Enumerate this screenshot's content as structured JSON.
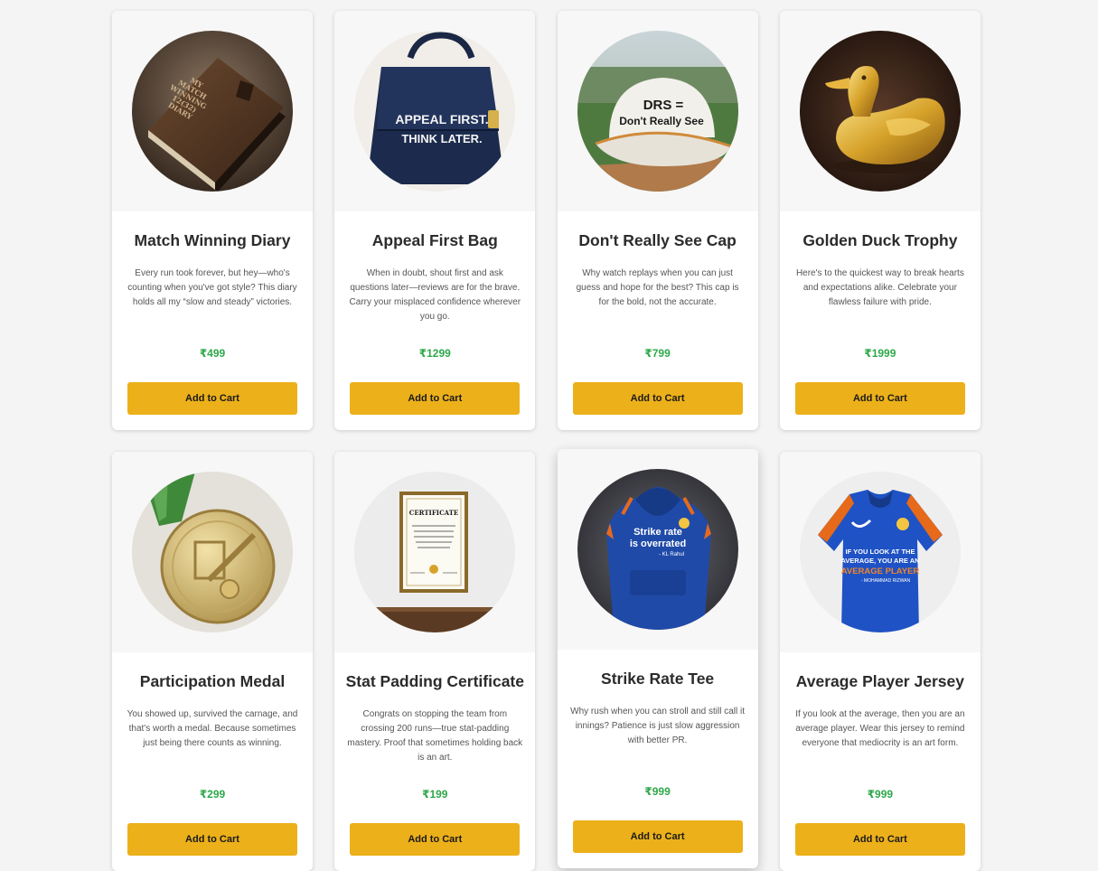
{
  "products": [
    {
      "title": "Match Winning Diary",
      "description": "Every run took forever, but hey—who's counting when you've got style? This diary holds all my “slow and steady” victories.",
      "price": "₹499",
      "button": "Add to Cart",
      "image_text": "MY MATCH WINNING 12(32) DIARY",
      "icon": "diary-image"
    },
    {
      "title": "Appeal First Bag",
      "description": "When in doubt, shout first and ask questions later—reviews are for the brave. Carry your misplaced confidence wherever you go.",
      "price": "₹1299",
      "button": "Add to Cart",
      "image_text": "APPEAL FIRST. THINK LATER.",
      "icon": "bag-image"
    },
    {
      "title": "Don't Really See Cap",
      "description": "Why watch replays when you can just guess and hope for the best? This cap is for the bold, not the accurate.",
      "price": "₹799",
      "button": "Add to Cart",
      "image_text": "DRS = Don't Really See",
      "icon": "cap-image"
    },
    {
      "title": "Golden Duck Trophy",
      "description": "Here's to the quickest way to break hearts and expectations alike. Celebrate your flawless failure with pride.",
      "price": "₹1999",
      "button": "Add to Cart",
      "icon": "duck-trophy-image"
    },
    {
      "title": "Participation Medal",
      "description": "You showed up, survived the carnage, and that's worth a medal. Because sometimes just being there counts as winning.",
      "price": "₹299",
      "button": "Add to Cart",
      "icon": "medal-image"
    },
    {
      "title": "Stat Padding Certificate",
      "description": "Congrats on stopping the team from crossing 200 runs—true stat-padding mastery. Proof that sometimes holding back is an art.",
      "price": "₹199",
      "button": "Add to Cart",
      "image_text": "CERTIFICATE",
      "icon": "certificate-image"
    },
    {
      "title": "Strike Rate Tee",
      "description": "Why rush when you can stroll and still call it innings? Patience is just slow aggression with better PR.",
      "price": "₹999",
      "button": "Add to Cart",
      "image_text": "Strike rate is overrated - KL Rahul",
      "icon": "hoodie-image"
    },
    {
      "title": "Average Player Jersey",
      "description": "If you look at the average, then you are an average player. Wear this jersey to remind everyone that mediocrity is an art form.",
      "price": "₹999",
      "button": "Add to Cart",
      "image_text": "IF YOU LOOK AT THE AVERAGE, YOU ARE AN AVERAGE PLAYER - MOHAMMAD RIZWAN",
      "icon": "jersey-image"
    }
  ],
  "colors": {
    "button": "#ecb01a",
    "price": "#2ea84a",
    "title": "#2b2b2b"
  }
}
